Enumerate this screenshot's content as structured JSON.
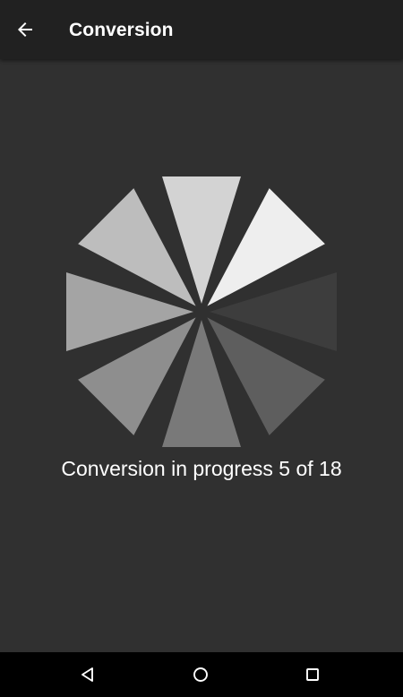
{
  "app_bar": {
    "title": "Conversion",
    "back_icon": "arrow-left-icon"
  },
  "main": {
    "progress_text": "Conversion in progress 5 of 18",
    "spinner_icon": "segmented-spinner-icon",
    "spinner_segment_shades": [
      "#d3d3d3",
      "#eeeeee",
      "#3d3d3d",
      "#5e5e5e",
      "#797979",
      "#8e8e8e",
      "#a4a4a4",
      "#bdbdbd"
    ]
  },
  "nav_bar": {
    "back_icon": "triangle-back-icon",
    "home_icon": "circle-home-icon",
    "recents_icon": "square-recents-icon"
  },
  "colors": {
    "app_bar": "#212121",
    "background": "#303030",
    "nav_bar": "#000000",
    "text": "#ffffff"
  }
}
